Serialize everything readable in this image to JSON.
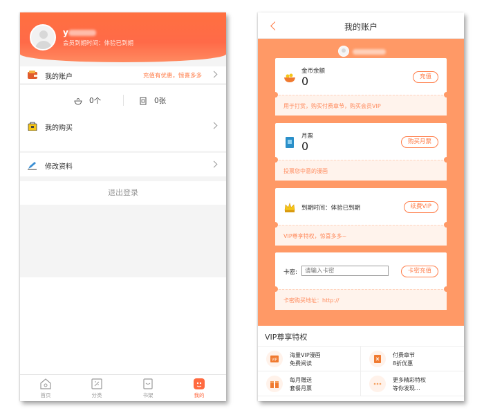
{
  "left": {
    "header": {
      "username": "y",
      "member_status": "会员到期时间：体验已到期",
      "gradient_start": "#ff7040",
      "gradient_end": "#ff8a60"
    },
    "account": {
      "label": "我的账户",
      "hint": "充值有优惠，惊喜多多"
    },
    "balances": {
      "coins": "0个",
      "tickets": "0张"
    },
    "purchase": {
      "label": "我的购买"
    },
    "edit": {
      "label": "修改资料"
    },
    "logout": {
      "label": "退出登录"
    },
    "tabs": [
      {
        "label": "首页",
        "icon": "home-icon",
        "active": false
      },
      {
        "label": "分类",
        "icon": "category-icon",
        "active": false
      },
      {
        "label": "书架",
        "icon": "bookshelf-icon",
        "active": false
      },
      {
        "label": "我的",
        "icon": "user-icon",
        "active": true
      }
    ],
    "accent": "#ff6a40"
  },
  "right": {
    "nav": {
      "title": "我的账户"
    },
    "accent_bg": "#ff9966",
    "coins": {
      "label": "金币余额",
      "value": "0",
      "button": "充值",
      "note": "用于打赏，购买付费章节，购买会员VIP"
    },
    "ticket": {
      "label": "月票",
      "value": "0",
      "button": "购买月票",
      "note": "投票您中意的漫画"
    },
    "vip": {
      "text": "到期时间：体验已到期",
      "button": "续费VIP",
      "note": "VIP尊享特权，惊喜多多~"
    },
    "card_key": {
      "label": "卡密:",
      "placeholder": "请输入卡密",
      "button": "卡密充值",
      "note": "卡密购买地址：http://"
    },
    "privileges": {
      "title": "VIP尊享特权",
      "items": [
        {
          "line1": "海量VIP漫画",
          "line2": "免费阅读",
          "icon": "vip-comic-icon"
        },
        {
          "line1": "付费章节",
          "line2": "8折优惠",
          "icon": "discount-icon"
        },
        {
          "line1": "每月赠送",
          "line2": "套餐月票",
          "icon": "gift-icon"
        },
        {
          "line1": "更多精彩特权",
          "line2": "等你发现...",
          "icon": "more-icon"
        }
      ]
    }
  }
}
